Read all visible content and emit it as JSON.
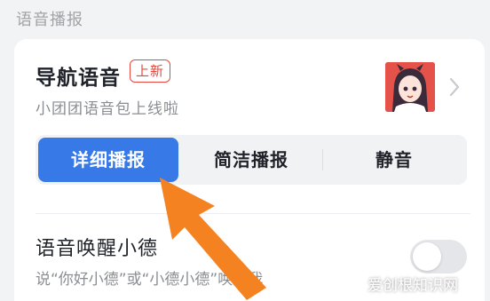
{
  "section_title": "语音播报",
  "nav_voice": {
    "title": "导航语音",
    "badge": "上新",
    "subtitle": "小团团语音包上线啦"
  },
  "broadcast_modes": {
    "selected": "详细播报",
    "options": [
      "详细播报",
      "简洁播报",
      "静音"
    ]
  },
  "wake_word": {
    "title": "语音唤醒小德",
    "subtitle": "说“你好小德”或“小德小德”唤醒我",
    "enabled": false
  },
  "watermark": "爱创根知识网",
  "colors": {
    "accent": "#3879e8",
    "badge": "#e8453c",
    "arrow": "#f58220",
    "background": "#f2f3f5"
  },
  "icons": [
    "chevron-right-icon",
    "arrow-annotation-icon"
  ]
}
